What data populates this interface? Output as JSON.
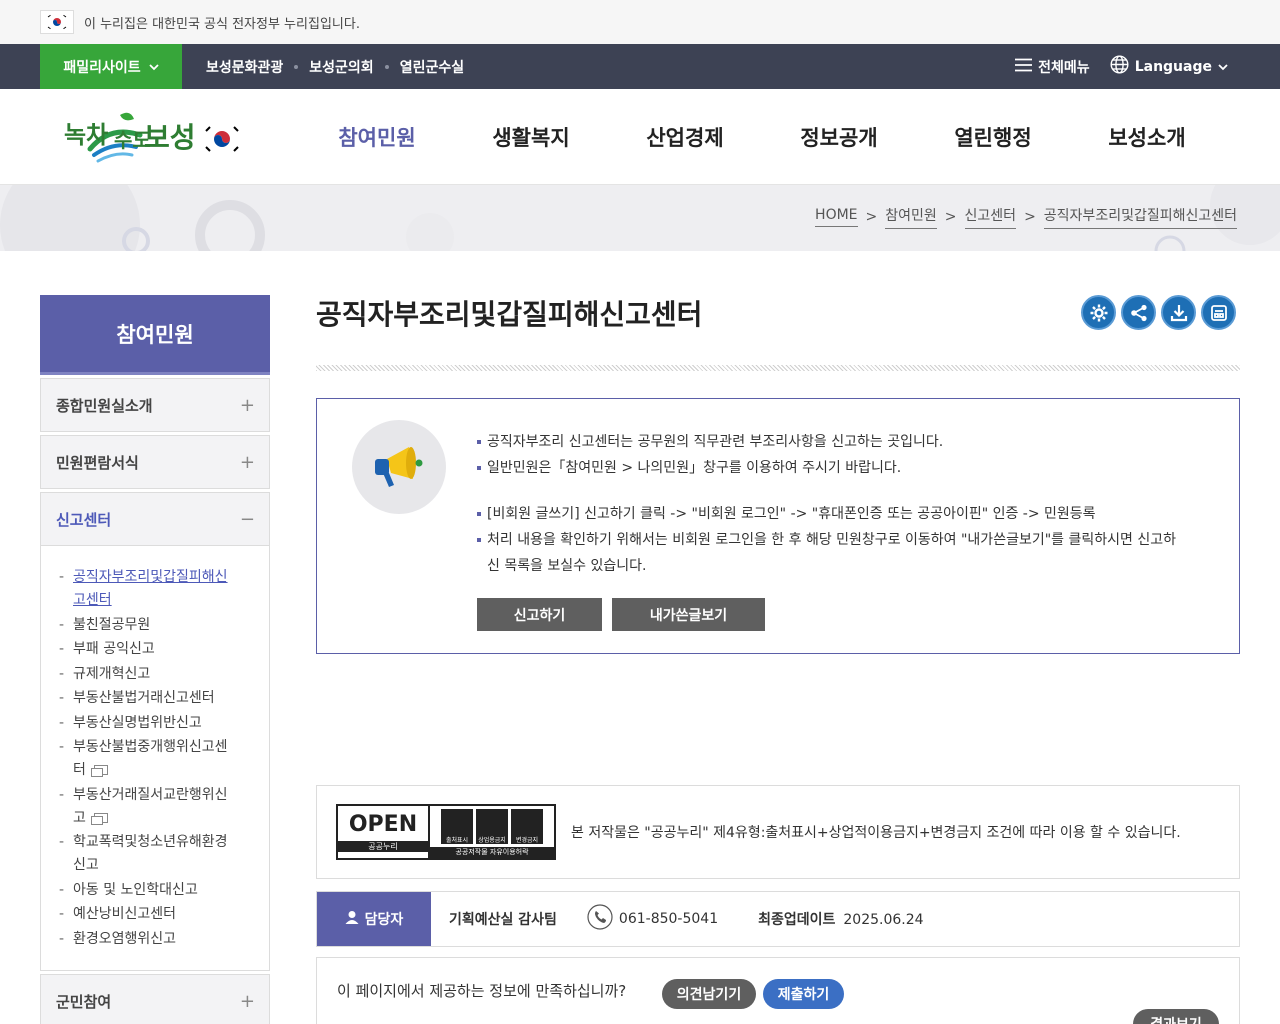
{
  "gov_banner": {
    "text": "이 누리집은 대한민국 공식 전자정부 누리집입니다."
  },
  "topbar": {
    "family_site": "패밀리사이트",
    "links": [
      "보성문화관광",
      "보성군의회",
      "열린군수실"
    ],
    "all_menu": "전체메뉴",
    "language": "Language"
  },
  "header": {
    "logo_text": "녹차수도보성",
    "menu": [
      "참여민원",
      "생활복지",
      "산업경제",
      "정보공개",
      "열린행정",
      "보성소개"
    ],
    "active_menu": "참여민원"
  },
  "breadcrumb": [
    "HOME",
    "참여민원",
    "신고센터",
    "공직자부조리및갑질피해신고센터"
  ],
  "sidebar": {
    "title": "참여민원",
    "sections": [
      {
        "label": "종합민원실소개",
        "toggle": "+"
      },
      {
        "label": "민원편람서식",
        "toggle": "+"
      },
      {
        "label": "신고센터",
        "toggle": "−"
      }
    ],
    "sub_items": [
      {
        "line1": "공직자부조리및갑질피해신",
        "line2": "고센터"
      },
      {
        "line1": "불친절공무원"
      },
      {
        "line1": "부패 공익신고"
      },
      {
        "line1": "규제개혁신고"
      },
      {
        "line1": "부동산불법거래신고센터"
      },
      {
        "line1": "부동산실명법위반신고"
      },
      {
        "line1": "부동산불법중개행위신고센",
        "line2": "터"
      },
      {
        "line1": "부동산거래질서교란행위신",
        "line2": "고"
      },
      {
        "line1": "학교폭력및청소년유해환경",
        "line2": "신고"
      },
      {
        "line1": "아동 및 노인학대신고"
      },
      {
        "line1": "예산낭비신고센터"
      },
      {
        "line1": "환경오염행위신고"
      }
    ],
    "bottom_section": {
      "label": "군민참여",
      "toggle": "+"
    }
  },
  "content": {
    "page_title": "공직자부조리및갑질피해신고센터",
    "tool_icons": [
      "settings-icon",
      "share-icon",
      "download-icon",
      "print-icon"
    ],
    "info": [
      "공직자부조리 신고센터는 공무원의 직무관련 부조리사항을 신고하는 곳입니다.",
      "일반민원은「참여민원 > 나의민원」창구를 이용하여 주시기 바랍니다.",
      "[비회원 글쓰기] 신고하기 클릭 -> \"비회원 로그인\" -> \"휴대폰인증 또는 공공아이핀\" 인증 -> 민원등록",
      "처리 내용을 확인하기 위해서는 비회원 로그인을 한 후 해당 민원창구로 이동하여 \"내가쓴글보기\"를 클릭하시면 신고하",
      "신 목록을 보실수 있습니다."
    ],
    "report_button": "신고하기",
    "my_posts_button": "내가쓴글보기"
  },
  "license": {
    "kogl_open": "OPEN",
    "kogl_sub": "공공누리",
    "kogl_icon_labels": [
      "출처표시",
      "상업용금지",
      "변경금지"
    ],
    "kogl_bottom": "공공저작물 자유이용허락",
    "text": "본 저작물은 \"공공누리\" 제4유형:출처표시+상업적이용금지+변경금지 조건에 따라 이용 할 수 있습니다."
  },
  "manager": {
    "label": "담당자",
    "department": "기획예산실 감사팀",
    "phone": "061-850-5041",
    "updated_label": "최종업데이트",
    "updated_date": "2025.06.24"
  },
  "survey": {
    "question": "이 페이지에서 제공하는 정보에 만족하십니까?",
    "opinion_button": "의견남기기",
    "submit_button": "제출하기",
    "result_button": "결과보기"
  },
  "colors": {
    "brand": "#5b5fa8",
    "topbar": "#3d4254",
    "family_green": "#37a63a",
    "tool_blue": "#1e6fb5"
  }
}
